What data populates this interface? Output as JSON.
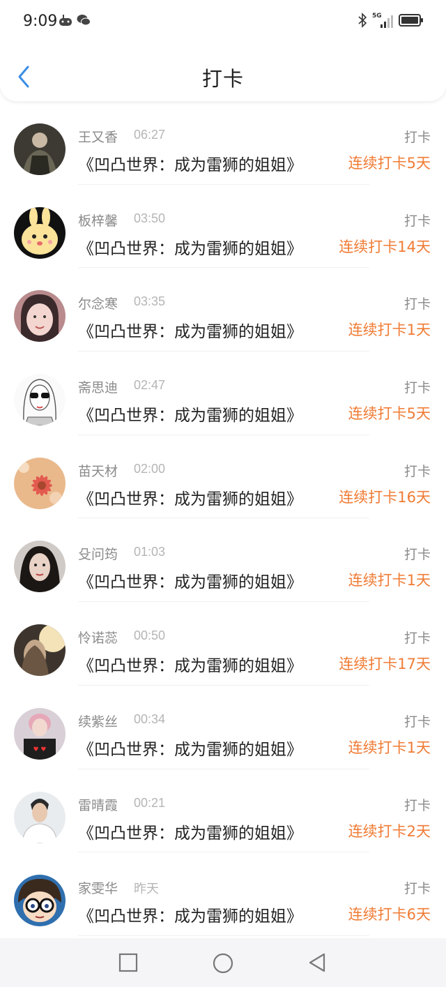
{
  "status_bar": {
    "time": "9:09",
    "network_label": "5G"
  },
  "header": {
    "title": "打卡"
  },
  "colors": {
    "accent_blue": "#3a8ee6",
    "streak_orange": "#f07b34"
  },
  "items": [
    {
      "name": "王又香",
      "time": "06:27",
      "book": "《凹凸世界：成为雷狮的姐姐》",
      "tag": "打卡",
      "streak": "连续打卡5天",
      "avatar": "avatar-photo-dark"
    },
    {
      "name": "板梓馨",
      "time": "03:50",
      "book": "《凹凸世界：成为雷狮的姐姐》",
      "tag": "打卡",
      "streak": "连续打卡14天",
      "avatar": "avatar-cartoon-rabbit"
    },
    {
      "name": "尔念寒",
      "time": "03:35",
      "book": "《凹凸世界：成为雷狮的姐姐》",
      "tag": "打卡",
      "streak": "连续打卡1天",
      "avatar": "avatar-photo-girl"
    },
    {
      "name": "斋思迪",
      "time": "02:47",
      "book": "《凹凸世界：成为雷狮的姐姐》",
      "tag": "打卡",
      "streak": "连续打卡5天",
      "avatar": "avatar-sketch-sunglasses"
    },
    {
      "name": "苗天材",
      "time": "02:00",
      "book": "《凹凸世界：成为雷狮的姐姐》",
      "tag": "打卡",
      "streak": "连续打卡16天",
      "avatar": "avatar-flower"
    },
    {
      "name": "殳问筠",
      "time": "01:03",
      "book": "《凹凸世界：成为雷狮的姐姐》",
      "tag": "打卡",
      "streak": "连续打卡1天",
      "avatar": "avatar-photo-woman"
    },
    {
      "name": "怜诺蕊",
      "time": "00:50",
      "book": "《凹凸世界：成为雷狮的姐姐》",
      "tag": "打卡",
      "streak": "连续打卡17天",
      "avatar": "avatar-photo-light"
    },
    {
      "name": "续紫丝",
      "time": "00:34",
      "book": "《凹凸世界：成为雷狮的姐姐》",
      "tag": "打卡",
      "streak": "连续打卡1天",
      "avatar": "avatar-photo-pink"
    },
    {
      "name": "雷晴霞",
      "time": "00:21",
      "book": "《凹凸世界：成为雷狮的姐姐》",
      "tag": "打卡",
      "streak": "连续打卡2天",
      "avatar": "avatar-photo-man"
    },
    {
      "name": "家雯华",
      "time": "昨天",
      "book": "《凹凸世界：成为雷狮的姐姐》",
      "tag": "打卡",
      "streak": "连续打卡6天",
      "avatar": "avatar-cartoon-glasses"
    }
  ]
}
